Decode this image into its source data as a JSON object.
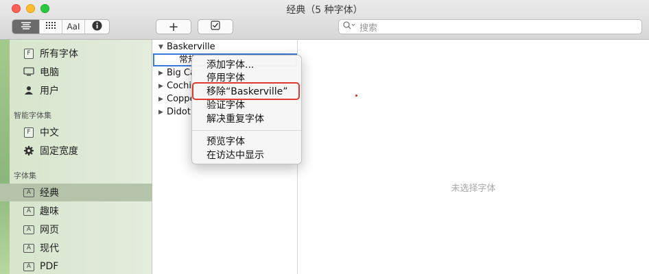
{
  "window": {
    "title": "经典（5 种字体）"
  },
  "toolbar": {
    "view_buttons": [
      "list-view",
      "grid-view",
      "sample-view",
      "info"
    ],
    "sample_label": "AaI",
    "add_label": "+",
    "check_label": "☑",
    "search_placeholder": "搜索"
  },
  "sidebar": {
    "top_items": [
      {
        "label": "所有字体",
        "icon": "font-book-icon"
      },
      {
        "label": "电脑",
        "icon": "computer-icon"
      },
      {
        "label": "用户",
        "icon": "user-icon"
      }
    ],
    "smart_header": "智能字体集",
    "smart_items": [
      {
        "label": "中文",
        "icon": "font-book-icon"
      },
      {
        "label": "固定宽度",
        "icon": "gear-icon"
      }
    ],
    "collections_header": "字体集",
    "collections": [
      {
        "label": "经典",
        "selected": true
      },
      {
        "label": "趣味"
      },
      {
        "label": "网页"
      },
      {
        "label": "现代"
      },
      {
        "label": "PDF"
      }
    ]
  },
  "font_list": {
    "families": [
      "Baskerville",
      "Big Ca",
      "Cochi",
      "Coppe",
      "Didot"
    ],
    "selected_style": "常规"
  },
  "context_menu": {
    "group1": [
      "添加字体...",
      "停用字体",
      "移除“Baskerville”",
      "验证字体",
      "解决重复字体"
    ],
    "group2": [
      "预览字体",
      "在访达中显示"
    ]
  },
  "preview": {
    "empty_text": "未选择字体"
  },
  "colors": {
    "highlight": "#e0392b",
    "selection_border": "#3a78d8"
  }
}
